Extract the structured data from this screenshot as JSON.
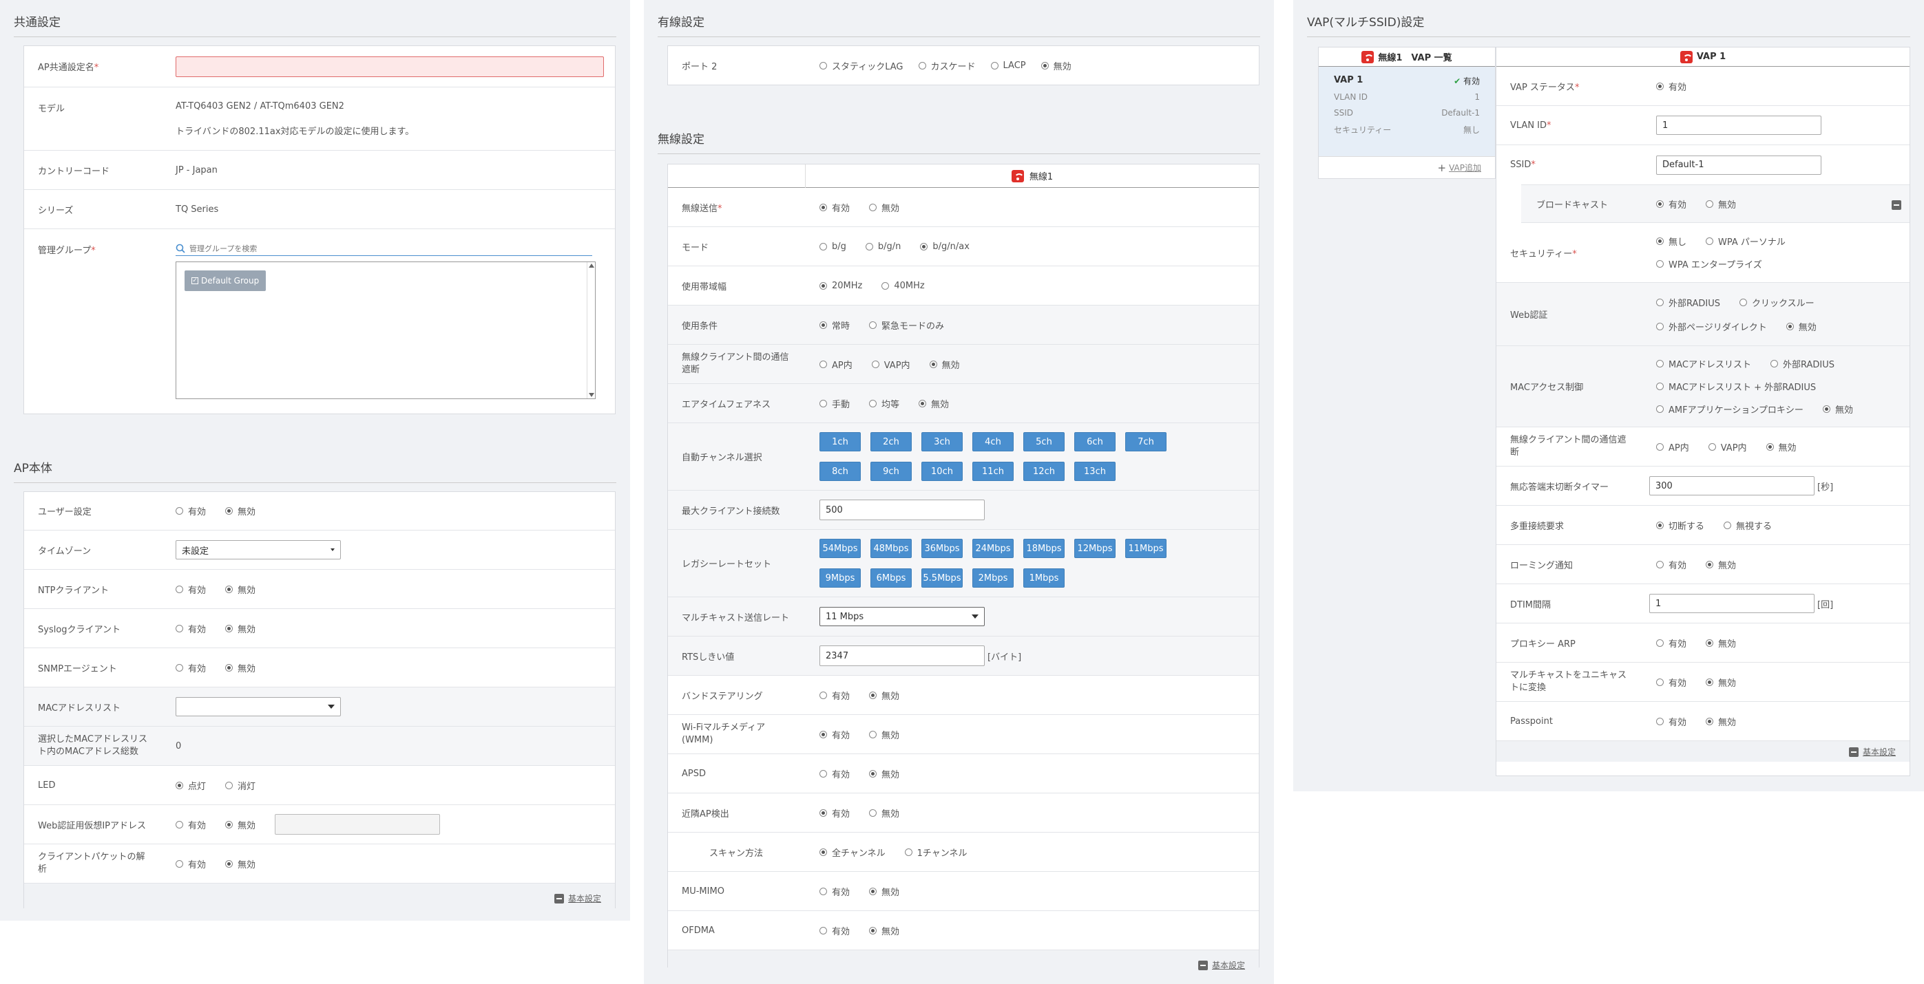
{
  "common": {
    "title": "共通設定",
    "ap_name_label": "AP共通設定名",
    "model_label": "モデル",
    "model_value": "AT-TQ6403 GEN2 / AT-TQm6403 GEN2",
    "model_note": "トライバンドの802.11ax対応モデルの設定に使用します。",
    "country_label": "カントリーコード",
    "country_value": "JP - Japan",
    "series_label": "シリーズ",
    "series_value": "TQ Series",
    "group_label": "管理グループ",
    "group_search_placeholder": "管理グループを検索",
    "group_item": "Default Group"
  },
  "ap": {
    "title": "AP本体",
    "opt_on": "有効",
    "opt_off": "無効",
    "user_label": "ユーザー設定",
    "tz_label": "タイムゾーン",
    "tz_value": "未設定",
    "ntp_label": "NTPクライアント",
    "syslog_label": "Syslogクライアント",
    "snmp_label": "SNMPエージェント",
    "mac_label": "MACアドレスリスト",
    "mac_count_label": "選択したMACアドレスリスト内のMACアドレス総数",
    "mac_count_value": "0",
    "led_label": "LED",
    "led_on": "点灯",
    "led_off": "消灯",
    "webip_label": "Web認証用仮想IPアドレス",
    "packet_label": "クライアントパケットの解析",
    "basic_link": "基本設定"
  },
  "wired": {
    "title": "有線設定",
    "port2_label": "ポート 2",
    "opts": [
      "スタティックLAG",
      "カスケード",
      "LACP",
      "無効"
    ]
  },
  "wireless": {
    "title": "無線設定",
    "radio_header": "無線1",
    "tx_label": "無線送信",
    "opt_on": "有効",
    "opt_off": "無効",
    "mode_label": "モード",
    "mode_opts": [
      "b/g",
      "b/g/n",
      "b/g/n/ax"
    ],
    "bw_label": "使用帯域幅",
    "bw_opts": [
      "20MHz",
      "40MHz"
    ],
    "cond_label": "使用条件",
    "cond_opts": [
      "常時",
      "緊急モードのみ"
    ],
    "isol_label": "無線クライアント間の通信遮断",
    "isol_opts": [
      "AP内",
      "VAP内",
      "無効"
    ],
    "atf_label": "エアタイムフェアネス",
    "atf_opts": [
      "手動",
      "均等",
      "無効"
    ],
    "chan_label": "自動チャンネル選択",
    "channels": [
      "1ch",
      "2ch",
      "3ch",
      "4ch",
      "5ch",
      "6ch",
      "7ch",
      "8ch",
      "9ch",
      "10ch",
      "11ch",
      "12ch",
      "13ch"
    ],
    "maxc_label": "最大クライアント接続数",
    "maxc_value": "500",
    "legacy_label": "レガシーレートセット",
    "rates": [
      "54Mbps",
      "48Mbps",
      "36Mbps",
      "24Mbps",
      "18Mbps",
      "12Mbps",
      "11Mbps",
      "9Mbps",
      "6Mbps",
      "5.5Mbps",
      "2Mbps",
      "1Mbps"
    ],
    "mcast_label": "マルチキャスト送信レート",
    "mcast_value": "11 Mbps",
    "rts_label": "RTSしきい値",
    "rts_value": "2347",
    "rts_unit": "[バイト]",
    "band_label": "バンドステアリング",
    "wmm_label": "Wi-Fiマルチメディア(WMM)",
    "apsd_label": "APSD",
    "near_label": "近隣AP検出",
    "scan_label": "スキャン方法",
    "scan_opts": [
      "全チャンネル",
      "1チャンネル"
    ],
    "mumimo_label": "MU-MIMO",
    "ofdma_label": "OFDMA",
    "basic_link": "基本設定"
  },
  "vap": {
    "title": "VAP(マルチSSID)設定",
    "list_header": "無線1　VAP 一覧",
    "detail_header": "VAP 1",
    "card_name": "VAP 1",
    "card_status": "有効",
    "card_vlan_label": "VLAN ID",
    "card_vlan_value": "1",
    "card_ssid_label": "SSID",
    "card_ssid_value": "Default-1",
    "card_sec_label": "セキュリティー",
    "card_sec_value": "無し",
    "add_link": "VAP追加",
    "opt_on": "有効",
    "opt_off": "無効",
    "status_label": "VAP ステータス",
    "vlan_label": "VLAN ID",
    "vlan_value": "1",
    "ssid_label": "SSID",
    "ssid_value": "Default-1",
    "bcast_label": "ブロードキャスト",
    "sec_label": "セキュリティー",
    "sec_none": "無し",
    "sec_wpa_p": "WPA パーソナル",
    "sec_wpa_e": "WPA エンタープライズ",
    "web_label": "Web認証",
    "web_ext": "外部RADIUS",
    "web_click": "クリックスルー",
    "web_redirect": "外部ページリダイレクト",
    "mac_label": "MACアクセス制御",
    "mac_list": "MACアドレスリスト",
    "mac_ext": "外部RADIUS",
    "mac_list_ext": "MACアドレスリスト + 外部RADIUS",
    "mac_amf": "AMFアプリケーションプロキシー",
    "isol_label": "無線クライアント間の通信遮断",
    "isol_ap": "AP内",
    "isol_vap": "VAP内",
    "idle_label": "無応答端末切断タイマー",
    "idle_value": "300",
    "idle_unit": "[秒]",
    "multi_label": "多重接続要求",
    "multi_deny": "切断する",
    "multi_ignore": "無視する",
    "roam_label": "ローミング通知",
    "dtim_label": "DTIM間隔",
    "dtim_value": "1",
    "dtim_unit": "[回]",
    "parp_label": "プロキシー ARP",
    "m2u_label": "マルチキャストをユニキャストに変換",
    "pass_label": "Passpoint",
    "basic_link": "基本設定"
  }
}
